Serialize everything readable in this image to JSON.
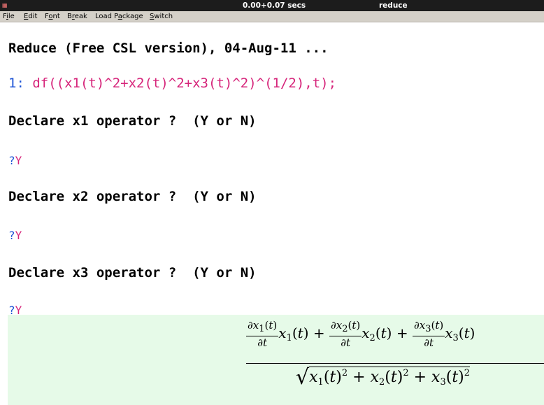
{
  "titlebar": {
    "timing": "0.00+0.07 secs",
    "title": "reduce",
    "app_icon": "reduce-app-icon"
  },
  "menu": {
    "items": [
      {
        "pre": "F",
        "ul": "i",
        "post": "le"
      },
      {
        "pre": "",
        "ul": "E",
        "post": "dit"
      },
      {
        "pre": "F",
        "ul": "o",
        "post": "nt"
      },
      {
        "pre": "B",
        "ul": "r",
        "post": "eak"
      },
      {
        "pre": "Load P",
        "ul": "a",
        "post": "ckage"
      },
      {
        "pre": "",
        "ul": "S",
        "post": "witch"
      }
    ]
  },
  "console": {
    "banner": "Reduce (Free CSL version), 04-Aug-11 ...",
    "prompt_num": "1:",
    "input": "df((x1(t)^2+x2(t)^2+x3(t)^2)^(1/2),t);",
    "q1": "Declare x1 operator ?  (Y or N)",
    "q2": "Declare x2 operator ?  (Y or N)",
    "q3": "Declare x3 operator ?  (Y or N)",
    "qmark": "?",
    "answer": "Y"
  },
  "result": {
    "partial": "∂",
    "t": "t",
    "x": "x",
    "subs": [
      "1",
      "2",
      "3"
    ],
    "plus": "+",
    "lparen": "(",
    "rparen": ")",
    "sq": "2",
    "sqrt": "√"
  },
  "colors": {
    "result_bg": "#e6fae8",
    "prompt": "#1f55d6",
    "input": "#d6247a",
    "titlebar": "#1c1c1c",
    "menubar": "#d4d0c8"
  }
}
